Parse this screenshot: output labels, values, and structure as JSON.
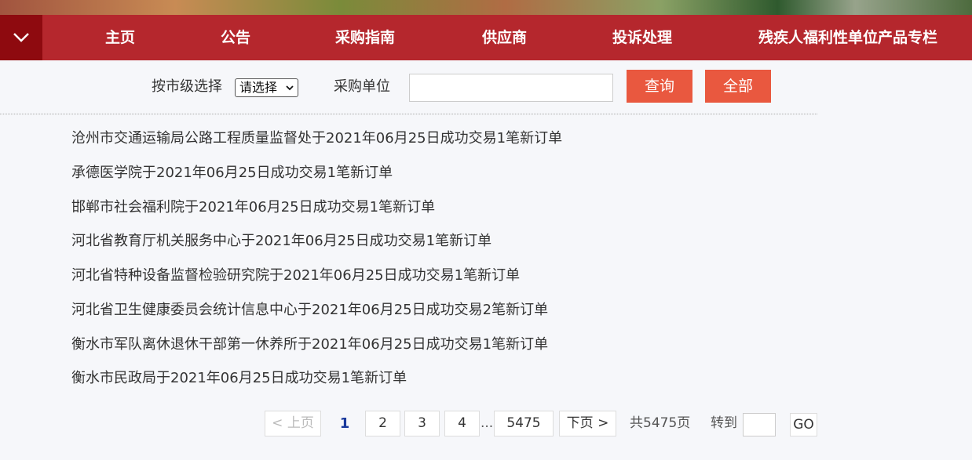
{
  "nav": {
    "items": [
      "主页",
      "公告",
      "采购指南",
      "供应商",
      "投诉处理",
      "残疾人福利性单位产品专栏"
    ]
  },
  "filter": {
    "city_label": "按市级选择",
    "city_select_value": "请选择",
    "unit_label": "采购单位",
    "unit_input_value": "",
    "query_button": "查询",
    "all_button": "全部"
  },
  "list": [
    "沧州市交通运输局公路工程质量监督处于2021年06月25日成功交易1笔新订单",
    "承德医学院于2021年06月25日成功交易1笔新订单",
    "邯郸市社会福利院于2021年06月25日成功交易1笔新订单",
    "河北省教育厅机关服务中心于2021年06月25日成功交易1笔新订单",
    "河北省特种设备监督检验研究院于2021年06月25日成功交易1笔新订单",
    "河北省卫生健康委员会统计信息中心于2021年06月25日成功交易2笔新订单",
    "衡水市军队离休退休干部第一休养所于2021年06月25日成功交易1笔新订单",
    "衡水市民政局于2021年06月25日成功交易1笔新订单"
  ],
  "pagination": {
    "prev": "< 上页",
    "pages": [
      "1",
      "2",
      "3",
      "4"
    ],
    "ellipsis": "...",
    "last": "5475",
    "next": "下页 >",
    "total": "共5475页",
    "jump_label": "转到",
    "jump_value": "",
    "go": "GO"
  },
  "colors": {
    "nav_bg": "#b5272d",
    "nav_toggle_bg": "#8e0a0f",
    "button_bg": "#e9583f",
    "current_page": "#1a3a9c"
  }
}
